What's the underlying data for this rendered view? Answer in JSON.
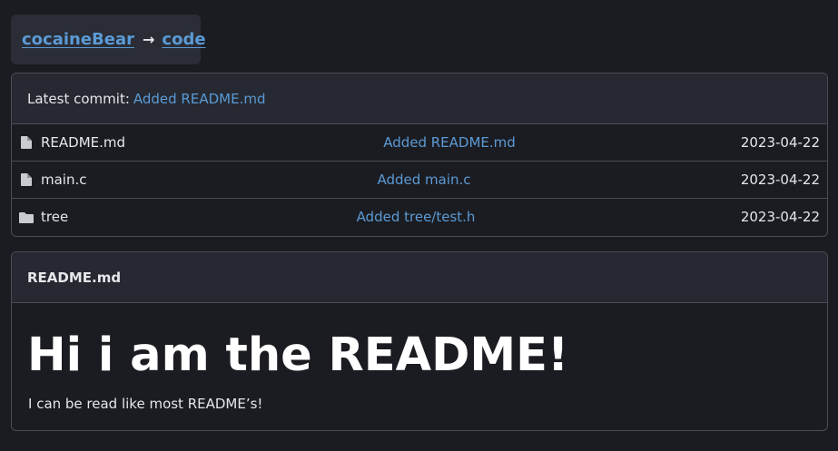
{
  "breadcrumb": {
    "owner": "cocaineBear",
    "separator": "→",
    "repo": "code"
  },
  "files": {
    "header_label": "Latest commit:",
    "latest_commit": "Added README.md",
    "rows": [
      {
        "name": "README.md",
        "type": "file",
        "icon": "file-icon",
        "commit": "Added README.md",
        "date": "2023-04-22"
      },
      {
        "name": "main.c",
        "type": "file",
        "icon": "file-icon",
        "commit": "Added main.c",
        "date": "2023-04-22"
      },
      {
        "name": "tree",
        "type": "folder",
        "icon": "folder-icon",
        "commit": "Added tree/test.h",
        "date": "2023-04-22"
      }
    ]
  },
  "readme": {
    "title": "README.md",
    "heading": "Hi i am the README!",
    "paragraph": "I can be read like most README’s!"
  },
  "colors": {
    "background": "#1b1c21",
    "panel_header": "#262931",
    "border": "#4a4d56",
    "link": "#5b9ad5",
    "text": "#e6e7ea"
  }
}
